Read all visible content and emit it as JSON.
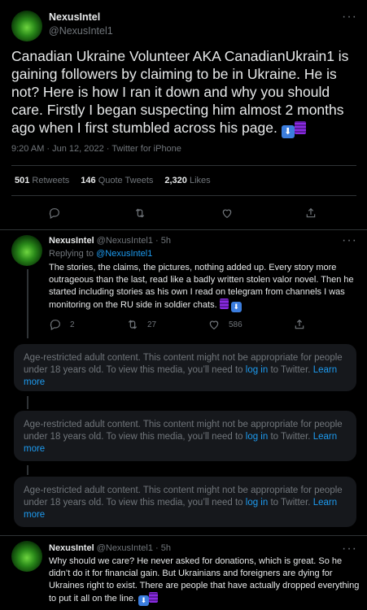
{
  "main_tweet": {
    "name": "NexusIntel",
    "handle": "@NexusIntel1",
    "text": "Canadian Ukraine Volunteer AKA CanadianUkrain1 is gaining followers by claiming to be in Ukraine. He is not? Here is how I ran it down and why you should care. Firstly I began suspecting him almost 2 months ago when I first stumbled across his page.",
    "emoji_arrow": "⬇",
    "meta": "9:20 AM · Jun 12, 2022 · Twitter for iPhone",
    "retweets_count": "501",
    "retweets_label": "Retweets",
    "quotes_count": "146",
    "quotes_label": "Quote Tweets",
    "likes_count": "2,320",
    "likes_label": "Likes"
  },
  "reply1": {
    "name": "NexusIntel",
    "handle": "@NexusIntel1 · 5h",
    "replying_prefix": "Replying to",
    "replying_handle": "@NexusIntel1",
    "text": "The stories, the claims, the pictures, nothing added up. Every story more outrageous than the last, read like a badly written stolen valor novel. Then he started including stories as his own I read on telegram from channels I was monitoring on the RU side in soldier chats.",
    "emoji_arrow": "⬇",
    "reply_count": "2",
    "retweet_count": "27",
    "like_count": "586"
  },
  "age_restricted": {
    "text": "Age-restricted adult content. This content might not be appropriate for people under 18 years old. To view this media, you’ll need to",
    "login": "log in",
    "suffix": "to Twitter.",
    "learn_more": "Learn more"
  },
  "reply2": {
    "name": "NexusIntel",
    "handle": "@NexusIntel1 · 5h",
    "text": "Why should we care? He never asked for donations, which is great. So he didn’t do it for financial gain. But Ukrainians and foreigners are dying for Ukraines right to exist. There are people that have actually dropped everything to put it all on the line.",
    "emoji_arrow": "⬇"
  },
  "colors": {
    "accent": "#1d9bf0",
    "background": "#000000",
    "muted": "#71767b"
  },
  "icons": [
    "reply-icon",
    "retweet-icon",
    "like-icon",
    "share-icon",
    "more-icon"
  ]
}
